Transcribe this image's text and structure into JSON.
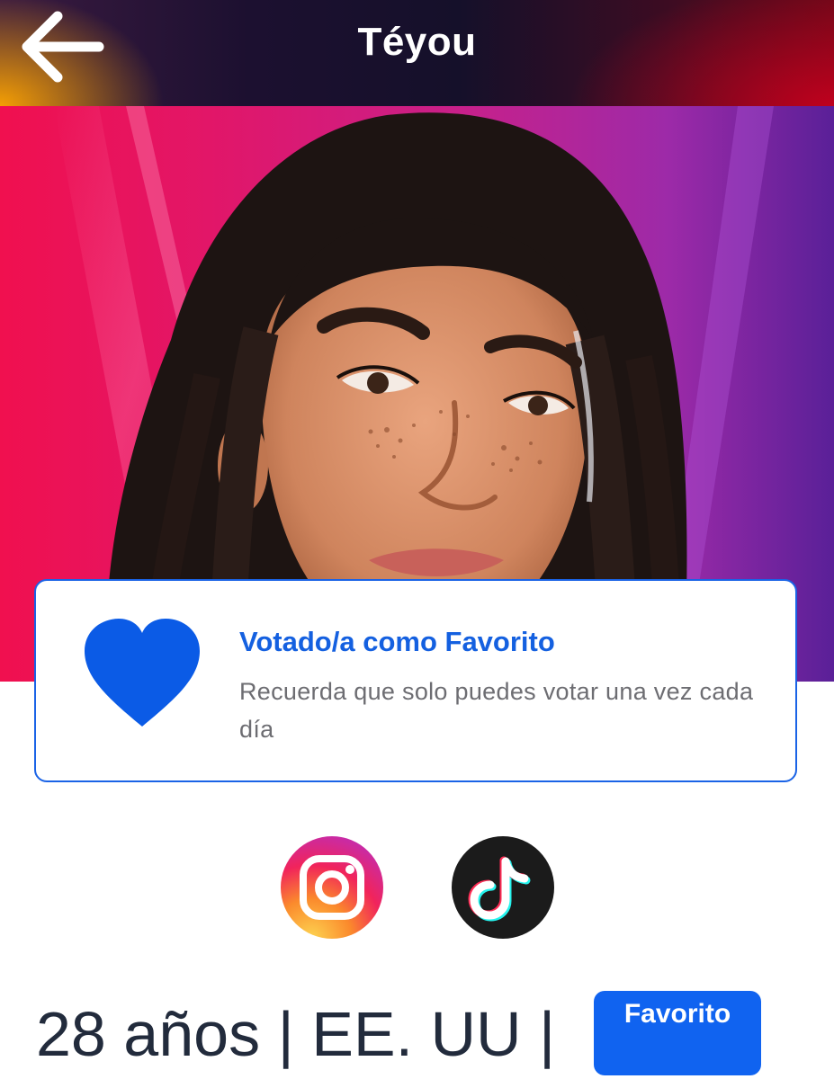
{
  "header": {
    "title": "Téyou",
    "back_icon": "arrow-left-icon"
  },
  "hero": {
    "image": "contestant-portrait"
  },
  "vote_card": {
    "icon": "heart-icon",
    "title": "Votado/a como Favorito",
    "subtitle": "Recuerda que solo puedes votar una vez cada día",
    "accent_color": "#1460e0"
  },
  "social": {
    "items": [
      {
        "name": "instagram",
        "icon": "instagram-icon"
      },
      {
        "name": "tiktok",
        "icon": "tiktok-icon"
      }
    ]
  },
  "info": {
    "age": "28 años",
    "country": "EE. UU",
    "separator": "|",
    "badge_label": "Favorito",
    "badge_color": "#1063f0"
  }
}
